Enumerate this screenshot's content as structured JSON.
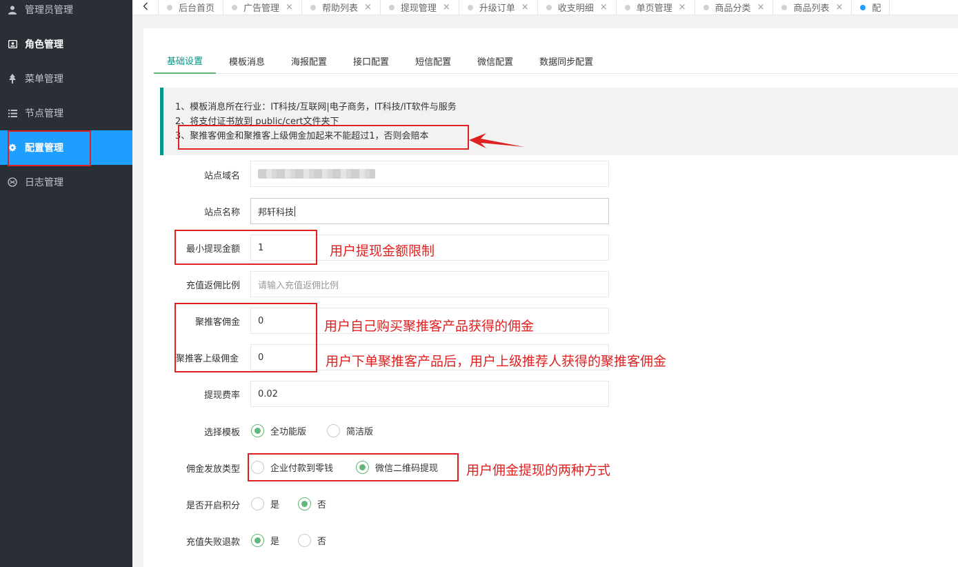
{
  "sidebar": {
    "items": [
      {
        "label": "管理员管理",
        "icon": "user-icon"
      },
      {
        "label": "角色管理",
        "icon": "id-card-icon"
      },
      {
        "label": "菜单管理",
        "icon": "tree-icon"
      },
      {
        "label": "节点管理",
        "icon": "list-icon"
      },
      {
        "label": "配置管理",
        "icon": "gear-icon"
      },
      {
        "label": "日志管理",
        "icon": "log-icon"
      }
    ]
  },
  "top_tabs": {
    "back_icon": "chevron-left-icon",
    "tabs": [
      {
        "label": "后台首页"
      },
      {
        "label": "广告管理"
      },
      {
        "label": "帮助列表"
      },
      {
        "label": "提现管理"
      },
      {
        "label": "升级订单"
      },
      {
        "label": "收支明细"
      },
      {
        "label": "单页管理"
      },
      {
        "label": "商品分类"
      },
      {
        "label": "商品列表"
      },
      {
        "label": "配"
      }
    ],
    "close_glyph": "×"
  },
  "sub_tabs": [
    "基础设置",
    "模板消息",
    "海报配置",
    "接口配置",
    "短信配置",
    "微信配置",
    "数据同步配置"
  ],
  "notice": {
    "line1": "1、模板消息所在行业：IT科技/互联网|电子商务，IT科技/IT软件与服务",
    "line2": "2、将支付证书放到 public/cert文件夹下",
    "line3_prefix": "3、",
    "line3": "聚推客佣金和聚推客上级佣金加起来不能超过1，否则会赔本"
  },
  "form": {
    "site_domain": {
      "label": "站点域名",
      "value": ""
    },
    "site_name": {
      "label": "站点名称",
      "value": "邦轩科技"
    },
    "min_withdraw": {
      "label": "最小提现金额",
      "value": "1"
    },
    "recharge_rebate": {
      "label": "充值返佣比例",
      "placeholder": "请输入充值返佣比例"
    },
    "jtk_commission": {
      "label": "聚推客佣金",
      "value": "0"
    },
    "jtk_parent_commission": {
      "label": "聚推客上级佣金",
      "value": "0"
    },
    "withdraw_fee": {
      "label": "提现费率",
      "value": "0.02"
    },
    "template": {
      "label": "选择模板",
      "options": [
        "全功能版",
        "简洁版"
      ],
      "selected": "全功能版"
    },
    "commission_type": {
      "label": "佣金发放类型",
      "options": [
        "企业付款到零钱",
        "微信二维码提现"
      ],
      "selected": "微信二维码提现"
    },
    "enable_points": {
      "label": "是否开启积分",
      "options": [
        "是",
        "否"
      ],
      "selected": "否"
    },
    "refund_on_fail": {
      "label": "充值失败退款",
      "options": [
        "是",
        "否"
      ],
      "selected": "是"
    }
  },
  "annotations": {
    "min_withdraw_note": "用户提现金额限制",
    "jtk_note": "用户自己购买聚推客产品获得的佣金",
    "jtk_parent_note": "用户下单聚推客产品后，用户上级推荐人获得的聚推客佣金",
    "commission_type_note": "用户佣金提现的两种方式",
    "color": "#e02020"
  },
  "colors": {
    "sidebar_bg": "#2a2f36",
    "sidebar_active": "#1e9fff",
    "accent_green": "#5fb878",
    "tab_active": "#009688"
  }
}
